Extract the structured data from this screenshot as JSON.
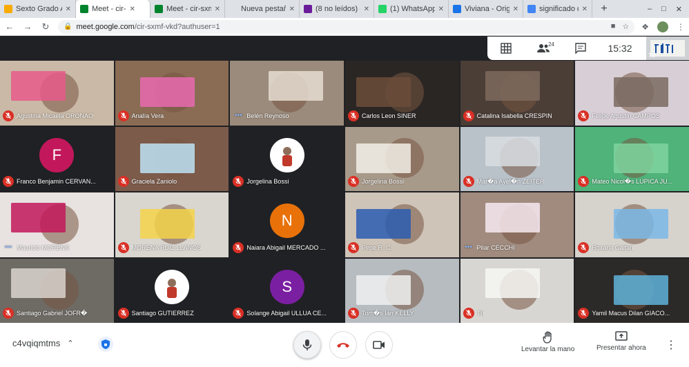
{
  "browser": {
    "tabs": [
      {
        "label": "Sexto Grado A",
        "color": "#f9ab00",
        "active": false
      },
      {
        "label": "Meet - cir-",
        "color": "#00832d",
        "active": true
      },
      {
        "label": "Meet - cir-sxmf",
        "color": "#00832d",
        "active": false
      },
      {
        "label": "Nueva pestaña",
        "color": "#dee1e6",
        "active": false
      },
      {
        "label": "(8 no leídos) - ",
        "color": "#6a1b9a",
        "active": false
      },
      {
        "label": "(1) WhatsApp",
        "color": "#25d366",
        "active": false
      },
      {
        "label": "Viviana - Orige",
        "color": "#1a73e8",
        "active": false
      },
      {
        "label": "significado de",
        "color": "#4285f4",
        "active": false
      }
    ],
    "url_domain": "meet.google.com",
    "url_path": "/cir-sxmf-vkd?authuser=1"
  },
  "meet": {
    "participant_count": "24",
    "clock": "15:32",
    "self_label": "Tú",
    "participants": [
      {
        "name": "Agustina Micaela ORONAO",
        "muted": true,
        "bg": "#c9b9a6",
        "accent": "#e85a8a"
      },
      {
        "name": "Analía Vera",
        "muted": true,
        "bg": "#8a6c55",
        "accent": "#e96ab0"
      },
      {
        "name": "Belén Reynoso",
        "muted": false,
        "bg": "#9b8b7c",
        "accent": "#e6ddd1"
      },
      {
        "name": "Carlos Leon SINER",
        "muted": true,
        "bg": "#2a2624",
        "accent": "#6b4e3a"
      },
      {
        "name": "Catalina Isabella CRESPIN",
        "muted": true,
        "bg": "#4b3e37",
        "accent": "#7c6a5d"
      },
      {
        "name": "Felipe Agustín CAMPOS",
        "muted": true,
        "bg": "#d7cfd5",
        "accent": "#7a6a62"
      },
      {
        "name": "Franco Benjamin CERVAN...",
        "muted": true,
        "bg": "#202124",
        "avatar": "F",
        "avatar_color": "#c2185b"
      },
      {
        "name": "Graciela Zaniolo",
        "muted": true,
        "bg": "#7d5b4b",
        "accent": "#bde3f5"
      },
      {
        "name": "Jorgelina Bossi",
        "muted": true,
        "bg": "#202124",
        "photo_avatar": true
      },
      {
        "name": "Jorgelina Bossi",
        "muted": true,
        "bg": "#a89a8a",
        "accent": "#f2efe8"
      },
      {
        "name": "Mar�a Ayel�n ZEITER",
        "muted": true,
        "bg": "#b9c1c9",
        "accent": "#d8dde2"
      },
      {
        "name": "Mateo Nicol�s LUPICA JU...",
        "muted": true,
        "bg": "#4fb37a",
        "accent": "#7fd39f"
      },
      {
        "name": "Mauricio MORENO",
        "muted": false,
        "bg": "#e8e2e0",
        "accent": "#c2185b"
      },
      {
        "name": "MORENA RUIZ LLANOS",
        "muted": true,
        "bg": "#d9d5cf",
        "accent": "#f3d34a"
      },
      {
        "name": "Naiara Abigail MERCADO ...",
        "muted": true,
        "bg": "#202124",
        "avatar": "N",
        "avatar_color": "#e8710a"
      },
      {
        "name": "Pepe R. C.",
        "muted": true,
        "bg": "#cfc4b8",
        "accent": "#2a5db0"
      },
      {
        "name": "Pilar CECCHI",
        "muted": false,
        "bg": "#a08b7e",
        "accent": "#f6e9f0"
      },
      {
        "name": "Roxana Gaitan",
        "muted": true,
        "bg": "#d6d2cc",
        "accent": "#7ab9e6"
      },
      {
        "name": "Santiago Gabriel JOFR�",
        "muted": true,
        "bg": "#6e6a64",
        "accent": "#d9d4cc"
      },
      {
        "name": "Santiago GUTIERREZ",
        "muted": true,
        "bg": "#202124",
        "photo_avatar": true
      },
      {
        "name": "Solange Abigail ULLUA CE...",
        "muted": true,
        "bg": "#202124",
        "avatar": "S",
        "avatar_color": "#7b1fa2"
      },
      {
        "name": "Tom�s Ian KELLY",
        "muted": true,
        "bg": "#b7bcc0",
        "accent": "#eef0f1"
      },
      {
        "name": "Tú",
        "muted": true,
        "bg": "#d8d6d2",
        "accent": "#f7f7f5"
      },
      {
        "name": "Yamil Macus Dilan GIACO...",
        "muted": true,
        "bg": "#2c2a28",
        "accent": "#5fb2d9"
      }
    ]
  },
  "controls": {
    "meeting_code": "c4vqiqmtms",
    "raise_hand_label": "Levantar la mano",
    "present_label": "Presentar ahora"
  }
}
